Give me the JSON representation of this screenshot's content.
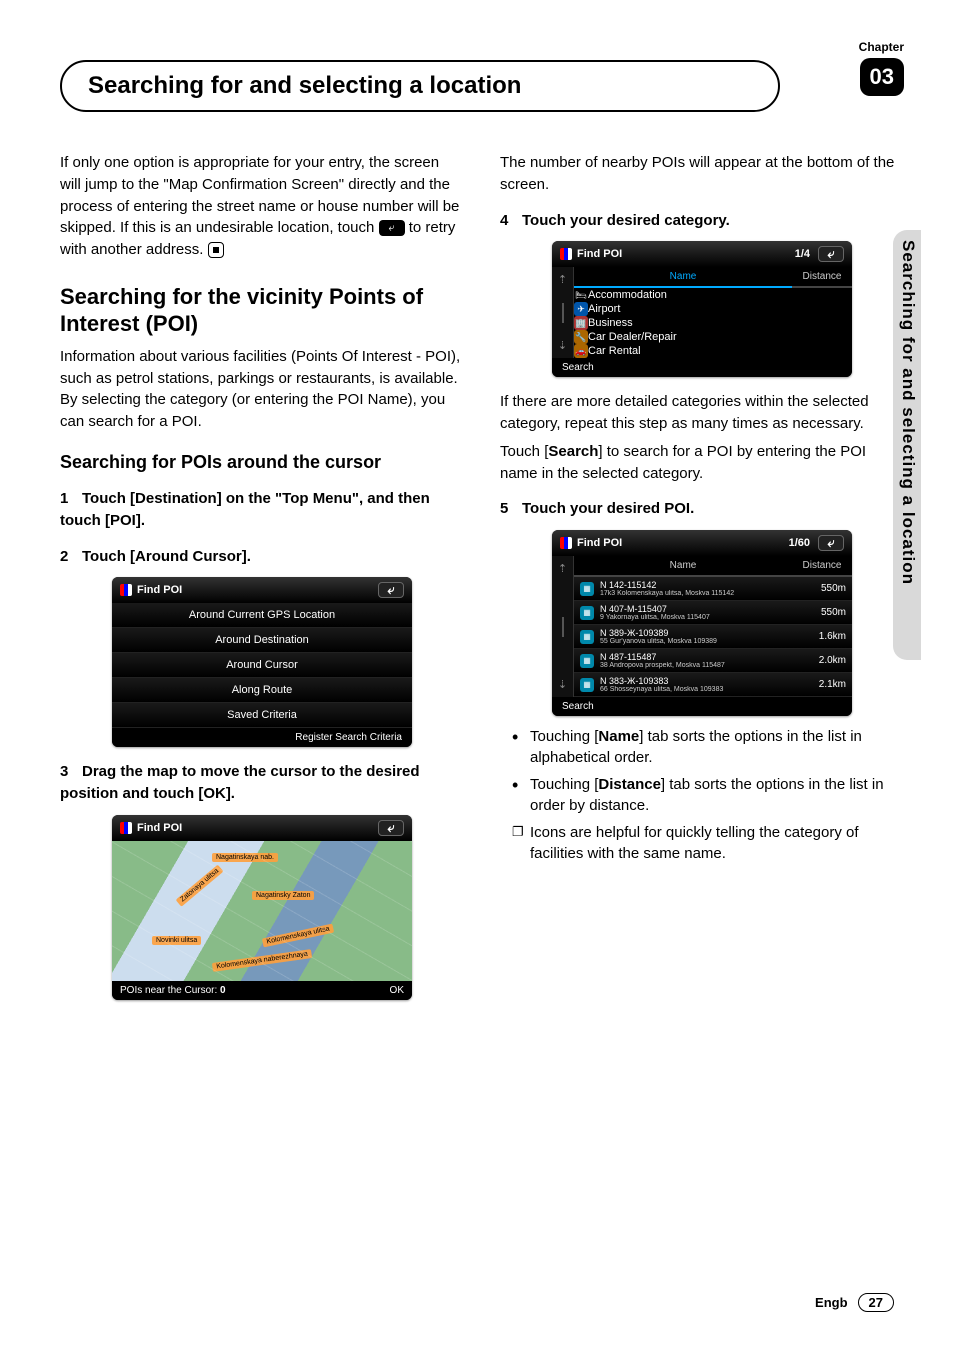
{
  "chapter": {
    "label": "Chapter",
    "num": "03"
  },
  "title": "Searching for and selecting a location",
  "side_tab": "Searching for and selecting a location",
  "left": {
    "intro": "If only one option is appropriate for your entry, the screen will jump to the \"Map Confirmation Screen\" directly and the process of entering the street name or house number will be skipped. If this is an undesirable location, touch",
    "intro_after": "to retry with another address.",
    "h2": "Searching for the vicinity Points of Interest (POI)",
    "h2_para": "Information about various facilities (Points Of Interest - POI), such as petrol stations, parkings or restaurants, is available. By selecting the category (or entering the POI Name), you can search for a POI.",
    "h3": "Searching for POIs around the cursor",
    "step1": "Touch [Destination] on the \"Top Menu\", and then touch [POI].",
    "step2": "Touch [Around Cursor].",
    "step3": "Drag the map to move the cursor to the desired position and touch [OK].",
    "dev1": {
      "title": "Find POI",
      "items": [
        "Around Current GPS Location",
        "Around Destination",
        "Around Cursor",
        "Along Route",
        "Saved Criteria"
      ],
      "footer": "Register Search Criteria"
    },
    "dev2": {
      "title": "Find POI",
      "labels": [
        "Nagatinskaya nab.",
        "Nagatinsky Zaton",
        "Zatonaya ulitsa",
        "Novinki ulitsa",
        "Kolomenskaya ulitsa",
        "Kolomenskaya naberezhnaya"
      ],
      "foot_left": "POIs near the Cursor:",
      "foot_count": "0",
      "foot_ok": "OK"
    }
  },
  "right": {
    "intro": "The number of nearby POIs will appear at the bottom of the screen.",
    "step4": "Touch your desired category.",
    "dev3": {
      "title": "Find POI",
      "page": "1/4",
      "tabs": {
        "name": "Name",
        "dist": "Distance"
      },
      "cats": [
        {
          "icon": "🛏",
          "color": "#a33",
          "label": "Accommodation"
        },
        {
          "icon": "✈",
          "color": "#05a",
          "label": "Airport"
        },
        {
          "icon": "🏢",
          "color": "#a33",
          "label": "Business"
        },
        {
          "icon": "🔧",
          "color": "#a60",
          "label": "Car Dealer/Repair"
        },
        {
          "icon": "🚗",
          "color": "#a60",
          "label": "Car Rental"
        }
      ],
      "search": "Search"
    },
    "para_after4a": "If there are more detailed categories within the selected category, repeat this step as many times as necessary.",
    "para_after4b_pre": "Touch [",
    "para_after4b_strong": "Search",
    "para_after4b_post": "] to search for a POI by entering the POI name in the selected category.",
    "step5": "Touch your desired POI.",
    "dev4": {
      "title": "Find POI",
      "page": "1/60",
      "tabs": {
        "name": "Name",
        "dist": "Distance"
      },
      "rows": [
        {
          "name": "N 142-115142",
          "addr": "17k3 Kolomenskaya ulitsa, Moskva 115142",
          "dist": "550m"
        },
        {
          "name": "N 407-M-115407",
          "addr": "9 Yakornaya ulitsa, Moskva 115407",
          "dist": "550m"
        },
        {
          "name": "N 389-Ж-109389",
          "addr": "55 Gur'yanova ulitsa, Moskva 109389",
          "dist": "1.6km"
        },
        {
          "name": "N 487-115487",
          "addr": "38 Andropova prospekt, Moskva 115487",
          "dist": "2.0km"
        },
        {
          "name": "N 383-Ж-109383",
          "addr": "66 Shosseynaya ulitsa, Moskva 109383",
          "dist": "2.1km"
        }
      ],
      "search": "Search"
    },
    "bullets": [
      {
        "pre": "Touching [",
        "strong": "Name",
        "post": "] tab sorts the options in the list in alphabetical order."
      },
      {
        "pre": "Touching [",
        "strong": "Distance",
        "post": "] tab sorts the options in the list in order by distance."
      }
    ],
    "bullet_sq": "Icons are helpful for quickly telling the category of facilities with the same name."
  },
  "footer": {
    "lang": "Engb",
    "page": "27"
  }
}
